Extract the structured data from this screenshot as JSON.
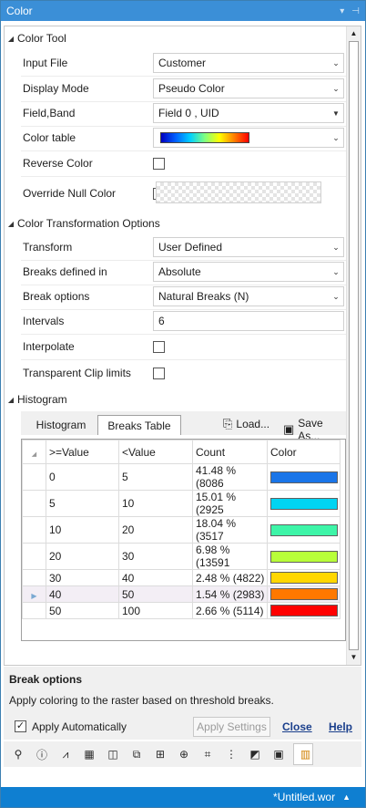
{
  "window": {
    "title": "Color"
  },
  "sections": {
    "color_tool": "Color Tool",
    "color_transform": "Color Transformation Options",
    "histogram": "Histogram"
  },
  "color_tool": {
    "input_file": {
      "label": "Input File",
      "value": "Customer"
    },
    "display_mode": {
      "label": "Display Mode",
      "value": "Pseudo Color"
    },
    "field_band": {
      "label": "Field,Band",
      "value": "Field 0 , UID"
    },
    "color_table": {
      "label": "Color table",
      "value": "rainbow-gradient"
    },
    "reverse_color": {
      "label": "Reverse Color",
      "checked": false
    },
    "override_null": {
      "label": "Override Null Color",
      "checked": false
    }
  },
  "transform": {
    "transform": {
      "label": "Transform",
      "value": "User Defined"
    },
    "breaks_defined": {
      "label": "Breaks defined in",
      "value": "Absolute"
    },
    "break_options": {
      "label": "Break options",
      "value": "Natural Breaks (N)"
    },
    "intervals": {
      "label": "Intervals",
      "value": "6"
    },
    "interpolate": {
      "label": "Interpolate",
      "checked": false
    },
    "transparent_clip": {
      "label": "Transparent Clip limits",
      "checked": false
    }
  },
  "histogram": {
    "tabs": [
      "Histogram",
      "Breaks Table"
    ],
    "active_tab": "Breaks Table",
    "load_label": "Load...",
    "save_label": "Save As...",
    "columns": [
      ">=Value",
      "<Value",
      "Count",
      "Color"
    ],
    "rows": [
      {
        "ge": "0",
        "lt": "5",
        "count": "41.48 % (8086",
        "color": "#1a75e8"
      },
      {
        "ge": "5",
        "lt": "10",
        "count": "15.01 % (2925",
        "color": "#00d4f2"
      },
      {
        "ge": "10",
        "lt": "20",
        "count": "18.04 % (3517",
        "color": "#3ef5a8"
      },
      {
        "ge": "20",
        "lt": "30",
        "count": "6.98 % (13591",
        "color": "#b8ff3a"
      },
      {
        "ge": "30",
        "lt": "40",
        "count": "2.48 % (4822)",
        "color": "#ffd700"
      },
      {
        "ge": "40",
        "lt": "50",
        "count": "1.54 % (2983)",
        "color": "#ff7800"
      },
      {
        "ge": "50",
        "lt": "100",
        "count": "2.66 % (5114)",
        "color": "#ff0000"
      }
    ],
    "selected_row": 5
  },
  "help": {
    "title": "Break options",
    "description": "Apply coloring to the raster based on threshold breaks."
  },
  "footer": {
    "apply_auto_label": "Apply Automatically",
    "apply_auto_checked": true,
    "apply_settings_label": "Apply Settings",
    "close_label": "Close",
    "help_label": "Help"
  },
  "toolbar_icons": [
    "info-tool-icon",
    "info-circle-icon",
    "waveform-icon",
    "table-icon",
    "layer-icon",
    "stack-icon",
    "grid-icon",
    "globe-icon",
    "crop-icon",
    "legend-icon",
    "chart-icon",
    "image-icon",
    "color-palette-icon"
  ],
  "status": {
    "document": "*Untitled.wor"
  }
}
